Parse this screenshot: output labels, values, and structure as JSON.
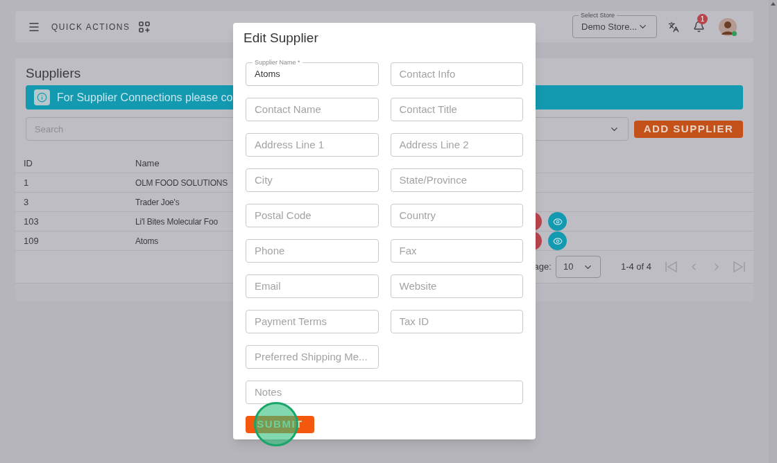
{
  "header": {
    "quick_actions": "QUICK ACTIONS",
    "store_select": {
      "label": "Select Store",
      "value": "Demo Store..."
    },
    "notifications": {
      "count": "1"
    },
    "avatar": {
      "online": true
    }
  },
  "suppliers": {
    "title": "Suppliers",
    "banner": "For Supplier Connections please co",
    "search": {
      "placeholder": "Search"
    },
    "add_button": "ADD SUPPLIER",
    "table": {
      "columns": [
        "ID",
        "Name"
      ],
      "rows": [
        {
          "id": "1",
          "name": "OLM FOOD SOLUTIONS",
          "actions_visible": false
        },
        {
          "id": "3",
          "name": "Trader Joe's",
          "actions_visible": false
        },
        {
          "id": "103",
          "name": "Li'l Bites Molecular Foo",
          "actions_visible": true
        },
        {
          "id": "109",
          "name": "Atoms",
          "actions_visible": true
        }
      ]
    },
    "pagination": {
      "rows_label": "age:",
      "rows_value": "10",
      "range": "1-4 of 4"
    }
  },
  "modal": {
    "title": "Edit Supplier",
    "fields": [
      {
        "kind": "filled",
        "label": "Supplier Name *",
        "value": "Atoms"
      },
      {
        "kind": "empty",
        "placeholder": "Contact Info"
      },
      {
        "kind": "empty",
        "placeholder": "Contact Name"
      },
      {
        "kind": "empty",
        "placeholder": "Contact Title"
      },
      {
        "kind": "empty",
        "placeholder": "Address Line 1"
      },
      {
        "kind": "empty",
        "placeholder": "Address Line 2"
      },
      {
        "kind": "empty",
        "placeholder": "City"
      },
      {
        "kind": "empty",
        "placeholder": "State/Province"
      },
      {
        "kind": "empty",
        "placeholder": "Postal Code"
      },
      {
        "kind": "empty",
        "placeholder": "Country"
      },
      {
        "kind": "empty",
        "placeholder": "Phone"
      },
      {
        "kind": "empty",
        "placeholder": "Fax"
      },
      {
        "kind": "empty",
        "placeholder": "Email"
      },
      {
        "kind": "empty",
        "placeholder": "Website"
      },
      {
        "kind": "empty",
        "placeholder": "Payment Terms"
      },
      {
        "kind": "empty",
        "placeholder": "Tax ID"
      },
      {
        "kind": "empty",
        "placeholder": "Preferred Shipping Me..."
      },
      {
        "kind": "wide",
        "placeholder": "Notes"
      }
    ],
    "submit": "SUBMIT",
    "click_highlight": true
  }
}
